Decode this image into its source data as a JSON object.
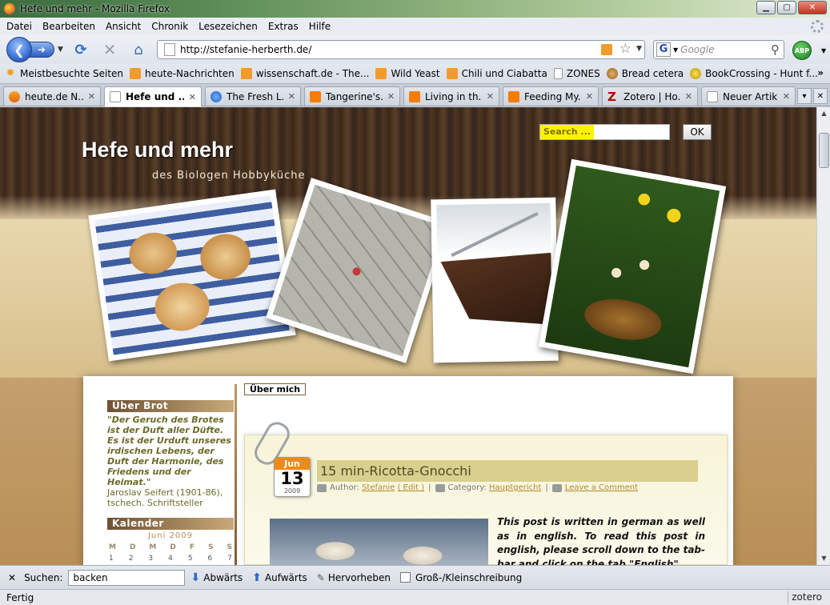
{
  "window": {
    "title": "Hefe und mehr - Mozilla Firefox"
  },
  "menu": [
    "Datei",
    "Bearbeiten",
    "Ansicht",
    "Chronik",
    "Lesezeichen",
    "Extras",
    "Hilfe"
  ],
  "nav": {
    "url": "http://stefanie-herberth.de/",
    "search_placeholder": "Google",
    "abp_label": "ABP"
  },
  "bookmarks": [
    {
      "label": "Meistbesuchte Seiten",
      "icon": "star"
    },
    {
      "label": "heute-Nachrichten",
      "icon": "rss"
    },
    {
      "label": "wissenschaft.de - The...",
      "icon": "rss"
    },
    {
      "label": "Wild Yeast",
      "icon": "rss"
    },
    {
      "label": "Chili und Ciabatta",
      "icon": "rss"
    },
    {
      "label": "ZONES",
      "icon": "page"
    },
    {
      "label": "Bread cetera",
      "icon": "bread"
    },
    {
      "label": "BookCrossing - Hunt f...",
      "icon": "bc"
    }
  ],
  "bookmarks_more": "»",
  "tabs": [
    {
      "label": "heute.de N...",
      "icon": "heute",
      "active": false
    },
    {
      "label": "Hefe und ...",
      "icon": "pg",
      "active": true
    },
    {
      "label": "The Fresh L...",
      "icon": "ie",
      "active": false
    },
    {
      "label": "Tangerine's...",
      "icon": "blogger",
      "active": false
    },
    {
      "label": "Living in th...",
      "icon": "blogger",
      "active": false
    },
    {
      "label": "Feeding My...",
      "icon": "blogger",
      "active": false
    },
    {
      "label": "Zotero | Ho...",
      "icon": "zot",
      "active": false
    },
    {
      "label": "Neuer Artik...",
      "icon": "pg",
      "active": false
    }
  ],
  "site": {
    "title": "Hefe und mehr",
    "subtitle": "des Biologen Hobbyküche",
    "search_placeholder": "Search ...",
    "ok": "OK",
    "sidebar": {
      "ueber_brot": "Über Brot",
      "quote": "\"Der Geruch des Brotes ist der Duft aller Düfte. Es ist der Urduft unseres irdischen Lebens, der Duft der Harmonie, des Friedens und der Heimat.\"",
      "quote_attr": "Jaroslav Seifert (1901-86), tschech. Schriftsteller",
      "kalender": "Kalender",
      "month": "Juni 2009",
      "weekdays": [
        "M",
        "D",
        "M",
        "D",
        "F",
        "S",
        "S"
      ],
      "dates": [
        "1",
        "2",
        "3",
        "4",
        "5",
        "6",
        "7"
      ]
    },
    "page_tab": "Über mich",
    "post": {
      "month": "Jun",
      "day": "13",
      "year": "2009",
      "title": "15 min-Ricotta-Gnocchi",
      "author_label": "Author:",
      "author": "Stefanie",
      "edit": "( Edit )",
      "category_label": "Category:",
      "category": "Hauptgericht",
      "comment": "Leave a Comment",
      "excerpt": "This post is written in german as well as in english. To read this post in english, please scroll down to the tab-bar and click on the tab \"English\"."
    }
  },
  "findbar": {
    "label": "Suchen:",
    "value": "backen",
    "next": "Abwärts",
    "prev": "Aufwärts",
    "highlight": "Hervorheben",
    "matchcase": "Groß-/Kleinschreibung"
  },
  "status": {
    "text": "Fertig",
    "zotero": "zotero"
  }
}
